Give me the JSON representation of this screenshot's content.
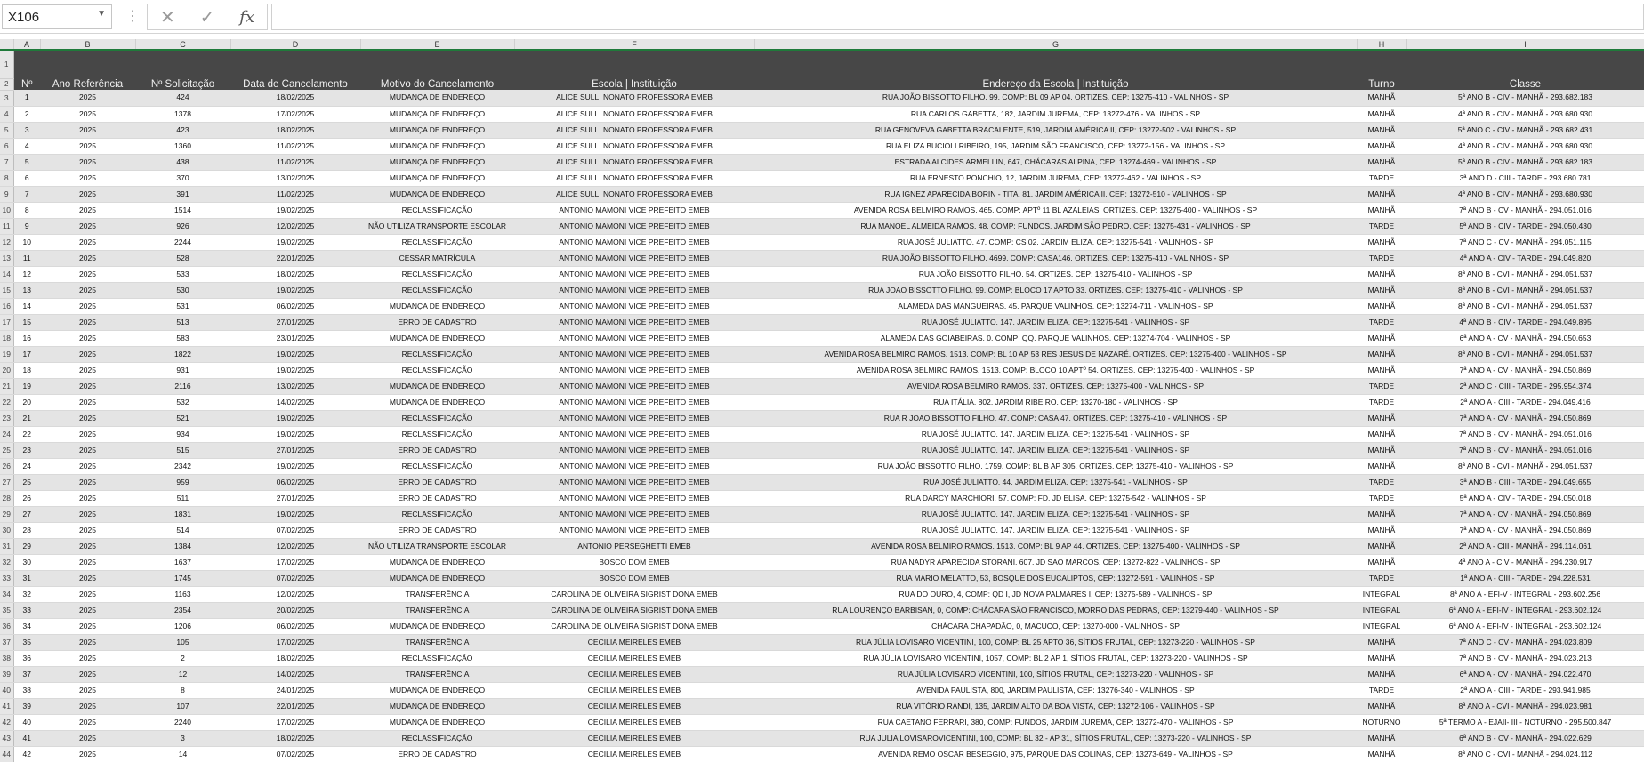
{
  "name_box": "X106",
  "formula_bar": "",
  "columns": [
    "A",
    "B",
    "C",
    "D",
    "E",
    "F",
    "G",
    "H",
    "I"
  ],
  "headers": [
    "Nº",
    "Ano Referência",
    "Nº Solicitação",
    "Data de Cancelamento",
    "Motivo do Cancelamento",
    "Escola | Instituição",
    "Endereço da Escola | Instituição",
    "Turno",
    "Classe"
  ],
  "rows": [
    [
      "1",
      "2025",
      "424",
      "18/02/2025",
      "MUDANÇA DE ENDEREÇO",
      "ALICE SULLI NONATO PROFESSORA EMEB",
      "RUA JOÃO BISSOTTO FILHO, 99, COMP: BL 09 AP 04, ORTIZES, CEP: 13275-410 - VALINHOS - SP",
      "MANHÃ",
      "5ª ANO B - CIV - MANHÃ - 293.682.183"
    ],
    [
      "2",
      "2025",
      "1378",
      "17/02/2025",
      "MUDANÇA DE ENDEREÇO",
      "ALICE SULLI NONATO PROFESSORA EMEB",
      "RUA CARLOS GABETTA, 182, JARDIM JUREMA, CEP: 13272-476 - VALINHOS - SP",
      "MANHÃ",
      "4ª ANO B - CIV - MANHÃ - 293.680.930"
    ],
    [
      "3",
      "2025",
      "423",
      "18/02/2025",
      "MUDANÇA DE ENDEREÇO",
      "ALICE SULLI NONATO PROFESSORA EMEB",
      "RUA GENOVEVA GABETTA BRACALENTE, 519, JARDIM AMÉRICA II, CEP: 13272-502 - VALINHOS - SP",
      "MANHÃ",
      "5ª ANO C - CIV - MANHÃ - 293.682.431"
    ],
    [
      "4",
      "2025",
      "1360",
      "11/02/2025",
      "MUDANÇA DE ENDEREÇO",
      "ALICE SULLI NONATO PROFESSORA EMEB",
      "RUA ELIZA BUCIOLI RIBEIRO, 195, JARDIM SÃO FRANCISCO, CEP: 13272-156 - VALINHOS - SP",
      "MANHÃ",
      "4ª ANO B - CIV - MANHÃ - 293.680.930"
    ],
    [
      "5",
      "2025",
      "438",
      "11/02/2025",
      "MUDANÇA DE ENDEREÇO",
      "ALICE SULLI NONATO PROFESSORA EMEB",
      "ESTRADA ALCIDES ARMELLIN, 647, CHÁCARAS ALPINA, CEP: 13274-469 - VALINHOS - SP",
      "MANHÃ",
      "5ª ANO B - CIV - MANHÃ - 293.682.183"
    ],
    [
      "6",
      "2025",
      "370",
      "13/02/2025",
      "MUDANÇA DE ENDEREÇO",
      "ALICE SULLI NONATO PROFESSORA EMEB",
      "RUA ERNESTO PONCHIO, 12, JARDIM JUREMA, CEP: 13272-462 - VALINHOS - SP",
      "TARDE",
      "3ª ANO D - CIII - TARDE - 293.680.781"
    ],
    [
      "7",
      "2025",
      "391",
      "11/02/2025",
      "MUDANÇA DE ENDEREÇO",
      "ALICE SULLI NONATO PROFESSORA EMEB",
      "RUA IGNEZ APARECIDA BORIN - TITA, 81, JARDIM AMÉRICA II, CEP: 13272-510 - VALINHOS - SP",
      "MANHÃ",
      "4ª ANO B - CIV - MANHÃ - 293.680.930"
    ],
    [
      "8",
      "2025",
      "1514",
      "19/02/2025",
      "RECLASSIFICAÇÃO",
      "ANTONIO MAMONI VICE PREFEITO EMEB",
      "AVENIDA ROSA BELMIRO RAMOS, 465, COMP: APTº 11 BL AZALEIAS, ORTIZES, CEP: 13275-400 - VALINHOS - SP",
      "MANHÃ",
      "7ª ANO B - CV - MANHÃ - 294.051.016"
    ],
    [
      "9",
      "2025",
      "926",
      "12/02/2025",
      "NÃO UTILIZA TRANSPORTE ESCOLAR",
      "ANTONIO MAMONI VICE PREFEITO EMEB",
      "RUA MANOEL ALMEIDA RAMOS, 48, COMP: FUNDOS, JARDIM SÃO PEDRO, CEP: 13275-431 - VALINHOS - SP",
      "TARDE",
      "5ª ANO B - CIV - TARDE - 294.050.430"
    ],
    [
      "10",
      "2025",
      "2244",
      "19/02/2025",
      "RECLASSIFICAÇÃO",
      "ANTONIO MAMONI VICE PREFEITO EMEB",
      "RUA JOSÉ JULIATTO, 47, COMP: CS 02, JARDIM ELIZA, CEP: 13275-541 - VALINHOS - SP",
      "MANHÃ",
      "7ª ANO C - CV - MANHÃ - 294.051.115"
    ],
    [
      "11",
      "2025",
      "528",
      "22/01/2025",
      "CESSAR MATRÍCULA",
      "ANTONIO MAMONI VICE PREFEITO EMEB",
      "RUA JOÃO BISSOTTO FILHO, 4699, COMP: CASA146, ORTIZES, CEP: 13275-410 - VALINHOS - SP",
      "TARDE",
      "4ª ANO A - CIV - TARDE - 294.049.820"
    ],
    [
      "12",
      "2025",
      "533",
      "18/02/2025",
      "RECLASSIFICAÇÃO",
      "ANTONIO MAMONI VICE PREFEITO EMEB",
      "RUA JOÃO BISSOTTO FILHO, 54, ORTIZES, CEP: 13275-410 - VALINHOS - SP",
      "MANHÃ",
      "8ª ANO B - CVI - MANHÃ - 294.051.537"
    ],
    [
      "13",
      "2025",
      "530",
      "19/02/2025",
      "RECLASSIFICAÇÃO",
      "ANTONIO MAMONI VICE PREFEITO EMEB",
      "RUA JOAO BISSOTTO FILHO, 99, COMP: BLOCO 17 APTO 33, ORTIZES, CEP: 13275-410 - VALINHOS - SP",
      "MANHÃ",
      "8ª ANO B - CVI - MANHÃ - 294.051.537"
    ],
    [
      "14",
      "2025",
      "531",
      "06/02/2025",
      "MUDANÇA DE ENDEREÇO",
      "ANTONIO MAMONI VICE PREFEITO EMEB",
      "ALAMEDA DAS MANGUEIRAS, 45, PARQUE VALINHOS, CEP: 13274-711 - VALINHOS - SP",
      "MANHÃ",
      "8ª ANO B - CVI - MANHÃ - 294.051.537"
    ],
    [
      "15",
      "2025",
      "513",
      "27/01/2025",
      "ERRO DE CADASTRO",
      "ANTONIO MAMONI VICE PREFEITO EMEB",
      "RUA JOSÉ JULIATTO, 147, JARDIM ELIZA, CEP: 13275-541 - VALINHOS - SP",
      "TARDE",
      "4ª ANO B - CIV - TARDE - 294.049.895"
    ],
    [
      "16",
      "2025",
      "583",
      "23/01/2025",
      "MUDANÇA DE ENDEREÇO",
      "ANTONIO MAMONI VICE PREFEITO EMEB",
      "ALAMEDA DAS GOIABEIRAS, 0, COMP: QQ, PARQUE VALINHOS, CEP: 13274-704 - VALINHOS - SP",
      "MANHÃ",
      "6ª ANO A - CV - MANHÃ - 294.050.653"
    ],
    [
      "17",
      "2025",
      "1822",
      "19/02/2025",
      "RECLASSIFICAÇÃO",
      "ANTONIO MAMONI VICE PREFEITO EMEB",
      "AVENIDA ROSA BELMIRO RAMOS, 1513, COMP: BL 10 AP 53 RES JESUS DE NAZARÉ, ORTIZES, CEP: 13275-400 - VALINHOS - SP",
      "MANHÃ",
      "8ª ANO B - CVI - MANHÃ - 294.051.537"
    ],
    [
      "18",
      "2025",
      "931",
      "19/02/2025",
      "RECLASSIFICAÇÃO",
      "ANTONIO MAMONI VICE PREFEITO EMEB",
      "AVENIDA ROSA BELMIRO RAMOS, 1513, COMP: BLOCO 10 APTº 54, ORTIZES, CEP: 13275-400 - VALINHOS - SP",
      "MANHÃ",
      "7ª ANO A - CV - MANHÃ - 294.050.869"
    ],
    [
      "19",
      "2025",
      "2116",
      "13/02/2025",
      "MUDANÇA DE ENDEREÇO",
      "ANTONIO MAMONI VICE PREFEITO EMEB",
      "AVENIDA ROSA BELMIRO RAMOS, 337, ORTIZES, CEP: 13275-400 - VALINHOS - SP",
      "TARDE",
      "2ª ANO C - CIII - TARDE - 295.954.374"
    ],
    [
      "20",
      "2025",
      "532",
      "14/02/2025",
      "MUDANÇA DE ENDEREÇO",
      "ANTONIO MAMONI VICE PREFEITO EMEB",
      "RUA ITÁLIA, 802, JARDIM RIBEIRO, CEP: 13270-180 - VALINHOS - SP",
      "TARDE",
      "2ª ANO A - CIII - TARDE - 294.049.416"
    ],
    [
      "21",
      "2025",
      "521",
      "19/02/2025",
      "RECLASSIFICAÇÃO",
      "ANTONIO MAMONI VICE PREFEITO EMEB",
      "RUA R JOAO BISSOTTO FILHO, 47, COMP: CASA 47, ORTIZES, CEP: 13275-410 - VALINHOS - SP",
      "MANHÃ",
      "7ª ANO A - CV - MANHÃ - 294.050.869"
    ],
    [
      "22",
      "2025",
      "934",
      "19/02/2025",
      "RECLASSIFICAÇÃO",
      "ANTONIO MAMONI VICE PREFEITO EMEB",
      "RUA JOSÉ JULIATTO, 147, JARDIM ELIZA, CEP: 13275-541 - VALINHOS - SP",
      "MANHÃ",
      "7ª ANO B - CV - MANHÃ - 294.051.016"
    ],
    [
      "23",
      "2025",
      "515",
      "27/01/2025",
      "ERRO DE CADASTRO",
      "ANTONIO MAMONI VICE PREFEITO EMEB",
      "RUA JOSÉ JULIATTO, 147, JARDIM ELIZA, CEP: 13275-541 - VALINHOS - SP",
      "MANHÃ",
      "7ª ANO B - CV - MANHÃ - 294.051.016"
    ],
    [
      "24",
      "2025",
      "2342",
      "19/02/2025",
      "RECLASSIFICAÇÃO",
      "ANTONIO MAMONI VICE PREFEITO EMEB",
      "RUA JOÃO BISSOTTO FILHO, 1759, COMP: BL B AP 305, ORTIZES, CEP: 13275-410 - VALINHOS - SP",
      "MANHÃ",
      "8ª ANO B - CVI - MANHÃ - 294.051.537"
    ],
    [
      "25",
      "2025",
      "959",
      "06/02/2025",
      "ERRO DE CADASTRO",
      "ANTONIO MAMONI VICE PREFEITO EMEB",
      "RUA JOSÉ JULIATTO, 44, JARDIM ELIZA, CEP: 13275-541 - VALINHOS - SP",
      "TARDE",
      "3ª ANO B - CIII - TARDE - 294.049.655"
    ],
    [
      "26",
      "2025",
      "511",
      "27/01/2025",
      "ERRO DE CADASTRO",
      "ANTONIO MAMONI VICE PREFEITO EMEB",
      "RUA DARCY MARCHIORI, 57, COMP: FD, JD ELISA, CEP: 13275-542 - VALINHOS - SP",
      "TARDE",
      "5ª ANO A - CIV - TARDE - 294.050.018"
    ],
    [
      "27",
      "2025",
      "1831",
      "19/02/2025",
      "RECLASSIFICAÇÃO",
      "ANTONIO MAMONI VICE PREFEITO EMEB",
      "RUA JOSÉ JULIATTO, 147, JARDIM ELIZA, CEP: 13275-541 - VALINHOS - SP",
      "MANHÃ",
      "7ª ANO A - CV - MANHÃ - 294.050.869"
    ],
    [
      "28",
      "2025",
      "514",
      "07/02/2025",
      "ERRO DE CADASTRO",
      "ANTONIO MAMONI VICE PREFEITO EMEB",
      "RUA JOSÉ JULIATTO, 147, JARDIM ELIZA, CEP: 13275-541 - VALINHOS - SP",
      "MANHÃ",
      "7ª ANO A - CV - MANHÃ - 294.050.869"
    ],
    [
      "29",
      "2025",
      "1384",
      "12/02/2025",
      "NÃO UTILIZA TRANSPORTE ESCOLAR",
      "ANTONIO PERSEGHETTI EMEB",
      "AVENIDA ROSA BELMIRO RAMOS, 1513, COMP: BL 9 AP 44, ORTIZES, CEP: 13275-400 - VALINHOS - SP",
      "MANHÃ",
      "2ª ANO A - CIII - MANHÃ - 294.114.061"
    ],
    [
      "30",
      "2025",
      "1637",
      "17/02/2025",
      "MUDANÇA DE ENDEREÇO",
      "BOSCO DOM EMEB",
      "RUA NADYR APARECIDA STORANI, 607, JD SAO MARCOS, CEP: 13272-822 - VALINHOS - SP",
      "MANHÃ",
      "4ª ANO A - CIV - MANHÃ - 294.230.917"
    ],
    [
      "31",
      "2025",
      "1745",
      "07/02/2025",
      "MUDANÇA DE ENDEREÇO",
      "BOSCO DOM EMEB",
      "RUA MARIO MELATTO, 53, BOSQUE DOS EUCALIPTOS, CEP: 13272-591 - VALINHOS - SP",
      "TARDE",
      "1ª ANO A - CIII - TARDE - 294.228.531"
    ],
    [
      "32",
      "2025",
      "1163",
      "12/02/2025",
      "TRANSFERÊNCIA",
      "CAROLINA DE OLIVEIRA SIGRIST DONA EMEB",
      "RUA DO OURO, 4, COMP: QD I, JD NOVA PALMARES I, CEP: 13275-589 - VALINHOS - SP",
      "INTEGRAL",
      "8ª ANO A - EFI-V - INTEGRAL - 293.602.256"
    ],
    [
      "33",
      "2025",
      "2354",
      "20/02/2025",
      "TRANSFERÊNCIA",
      "CAROLINA DE OLIVEIRA SIGRIST DONA EMEB",
      "RUA LOURENÇO BARBISAN, 0, COMP: CHÁCARA SÃO FRANCISCO, MORRO DAS PEDRAS, CEP: 13279-440 - VALINHOS - SP",
      "INTEGRAL",
      "6ª ANO A - EFI-IV - INTEGRAL - 293.602.124"
    ],
    [
      "34",
      "2025",
      "1206",
      "06/02/2025",
      "MUDANÇA DE ENDEREÇO",
      "CAROLINA DE OLIVEIRA SIGRIST DONA EMEB",
      "CHÁCARA CHAPADÃO, 0, MACUCO, CEP: 13270-000 - VALINHOS - SP",
      "INTEGRAL",
      "6ª ANO A - EFI-IV - INTEGRAL - 293.602.124"
    ],
    [
      "35",
      "2025",
      "105",
      "17/02/2025",
      "TRANSFERÊNCIA",
      "CECILIA MEIRELES EMEB",
      "RUA JÚLIA LOVISARO VICENTINI, 100, COMP: BL 25 APTO 36, SÍTIOS FRUTAL, CEP: 13273-220 - VALINHOS - SP",
      "MANHÃ",
      "7ª ANO C - CV - MANHÃ - 294.023.809"
    ],
    [
      "36",
      "2025",
      "2",
      "18/02/2025",
      "RECLASSIFICAÇÃO",
      "CECILIA MEIRELES EMEB",
      "RUA JÚLIA LOVISARO VICENTINI, 1057, COMP: BL 2 AP 1, SÍTIOS FRUTAL, CEP: 13273-220 - VALINHOS - SP",
      "MANHÃ",
      "7ª ANO B - CV - MANHÃ - 294.023.213"
    ],
    [
      "37",
      "2025",
      "12",
      "14/02/2025",
      "TRANSFERÊNCIA",
      "CECILIA MEIRELES EMEB",
      "RUA JÚLIA LOVISARO VICENTINI, 100, SÍTIOS FRUTAL, CEP: 13273-220 - VALINHOS - SP",
      "MANHÃ",
      "6ª ANO A - CV - MANHÃ - 294.022.470"
    ],
    [
      "38",
      "2025",
      "8",
      "24/01/2025",
      "MUDANÇA DE ENDEREÇO",
      "CECILIA MEIRELES EMEB",
      "AVENIDA PAULISTA, 800, JARDIM PAULISTA, CEP: 13276-340 - VALINHOS - SP",
      "TARDE",
      "2ª ANO A - CIII - TARDE - 293.941.985"
    ],
    [
      "39",
      "2025",
      "107",
      "22/01/2025",
      "MUDANÇA DE ENDEREÇO",
      "CECILIA MEIRELES EMEB",
      "RUA VITÓRIO RANDI, 135, JARDIM ALTO DA BOA VISTA, CEP: 13272-106 - VALINHOS - SP",
      "MANHÃ",
      "8ª ANO A - CVI - MANHÃ - 294.023.981"
    ],
    [
      "40",
      "2025",
      "2240",
      "17/02/2025",
      "MUDANÇA DE ENDEREÇO",
      "CECILIA MEIRELES EMEB",
      "RUA CAETANO FERRARI, 380, COMP: FUNDOS, JARDIM JUREMA, CEP: 13272-470 - VALINHOS - SP",
      "NOTURNO",
      "5ª TERMO A - EJAII- III - NOTURNO - 295.500.847"
    ],
    [
      "41",
      "2025",
      "3",
      "18/02/2025",
      "RECLASSIFICAÇÃO",
      "CECILIA MEIRELES EMEB",
      "RUA JULIA LOVISAROVICENTINI, 100, COMP: BL 32 - AP 31, SÍTIOS FRUTAL, CEP: 13273-220 - VALINHOS - SP",
      "MANHÃ",
      "6ª ANO B - CV - MANHÃ - 294.022.629"
    ],
    [
      "42",
      "2025",
      "14",
      "07/02/2025",
      "ERRO DE CADASTRO",
      "CECILIA MEIRELES EMEB",
      "AVENIDA REMO OSCAR BESEGGIO, 975, PARQUE DAS COLINAS, CEP: 13273-649 - VALINHOS - SP",
      "MANHÃ",
      "8ª ANO C - CVI - MANHÃ - 294.024.112"
    ]
  ]
}
